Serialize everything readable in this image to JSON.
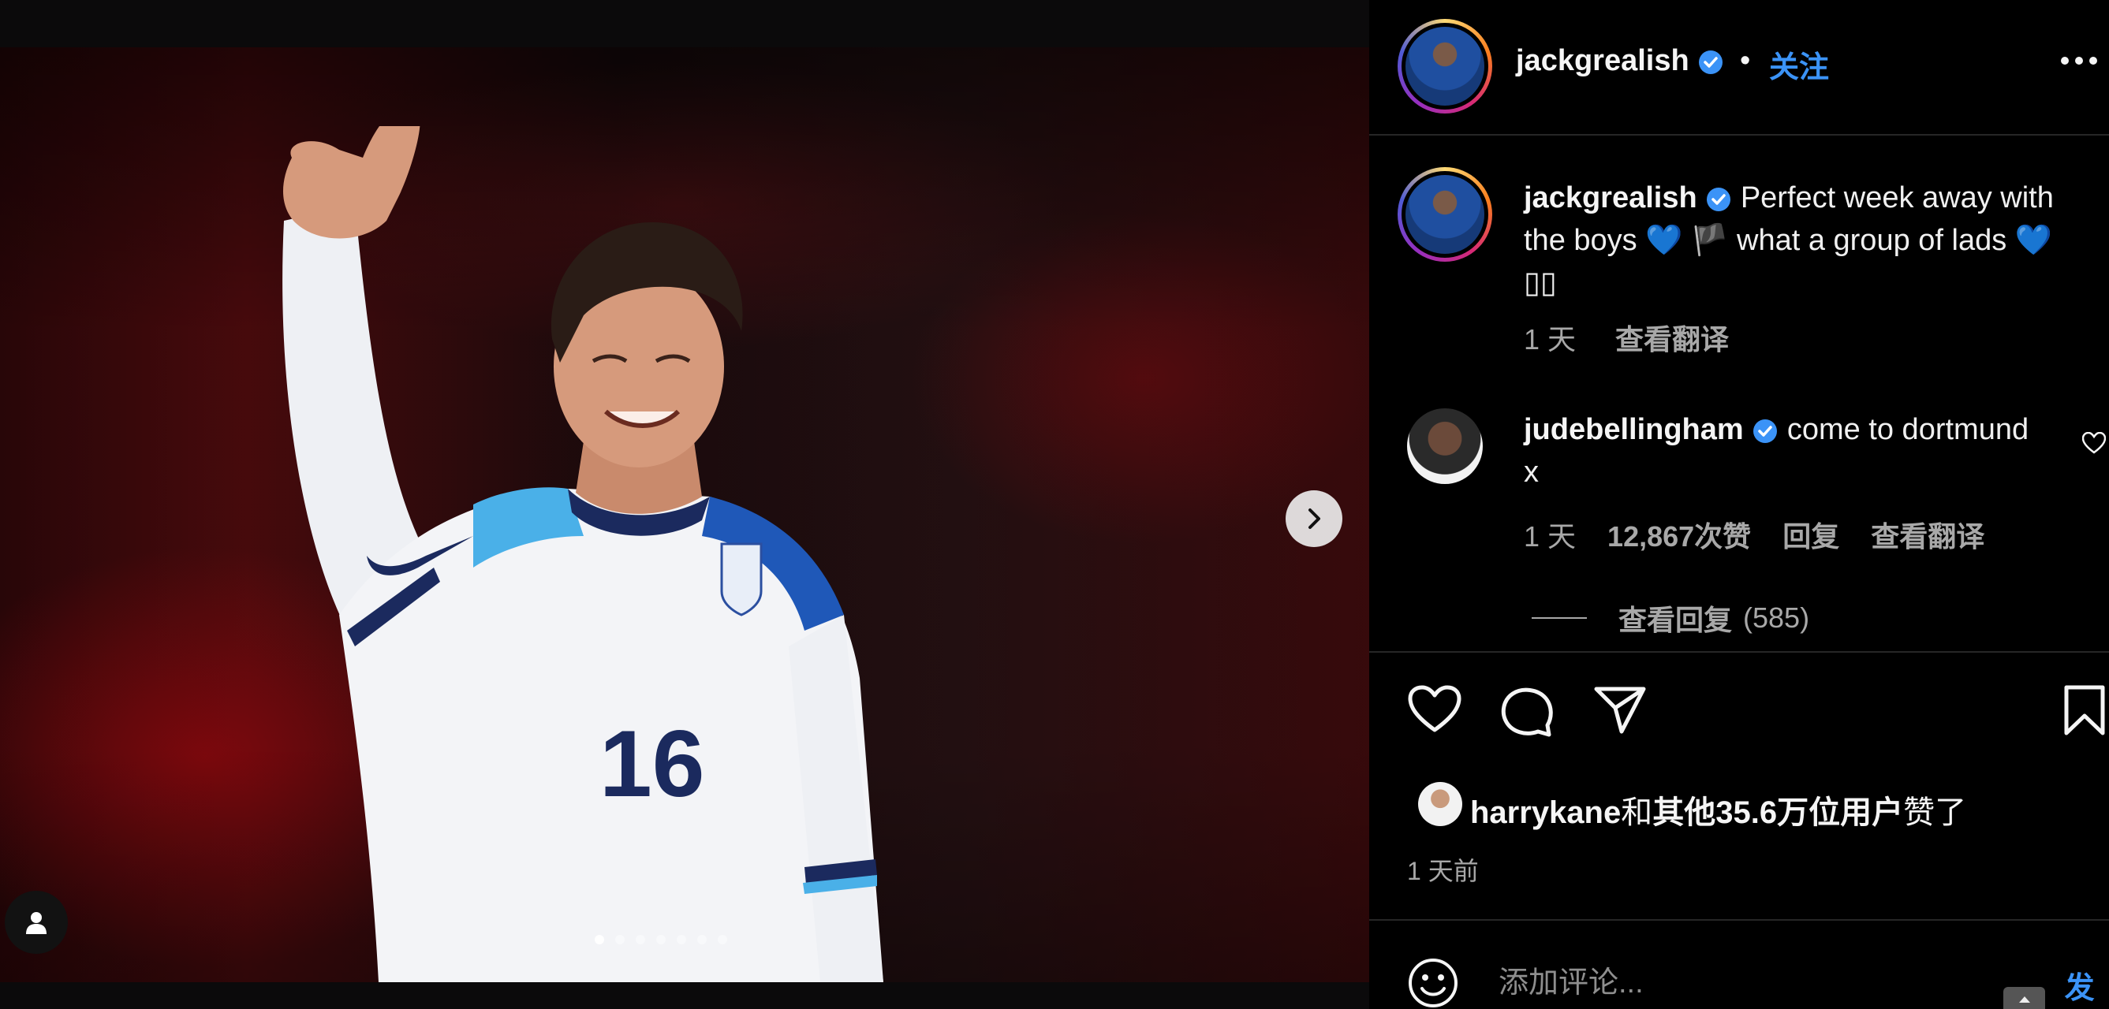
{
  "post": {
    "username": "jackgrealish",
    "follow_separator": "•",
    "follow_label": "关注",
    "caption_username": "jackgrealish",
    "caption_part1": "Perfect week away with the boys",
    "caption_heart1": "💙",
    "caption_flag": "🏴",
    "caption_part2": "what a group of lads",
    "caption_heart2": "💙",
    "caption_tail": "▯▯",
    "caption_age": "1 天",
    "caption_translate": "查看翻译",
    "likes_user": "harrykane",
    "likes_and": "和",
    "likes_others": "其他35.6万位用户",
    "likes_suffix": "赞了",
    "time_ago": "1 天前"
  },
  "comment": {
    "username": "judebellingham",
    "text": "come to dortmund x",
    "age": "1 天",
    "likes": "12,867次赞",
    "reply": "回复",
    "translate": "查看翻译",
    "view_replies": "查看回复",
    "reply_count": "(585)"
  },
  "comment_box": {
    "placeholder": "添加评论...",
    "post_label": "发布"
  },
  "media": {
    "jersey_number": "16",
    "carousel_count": 7,
    "carousel_active": 1
  },
  "colors": {
    "accent_blue": "#3b93f7",
    "muted_text": "#a8a8a8",
    "verified_badge": "#3b93f7"
  },
  "icons": {
    "next": "chevron-right-icon",
    "tag": "user-tag-icon",
    "more": "more-horizontal-icon",
    "like": "heart-icon",
    "comment": "comment-bubble-icon",
    "share": "paper-plane-icon",
    "save": "bookmark-icon",
    "emoji": "smiley-icon"
  }
}
